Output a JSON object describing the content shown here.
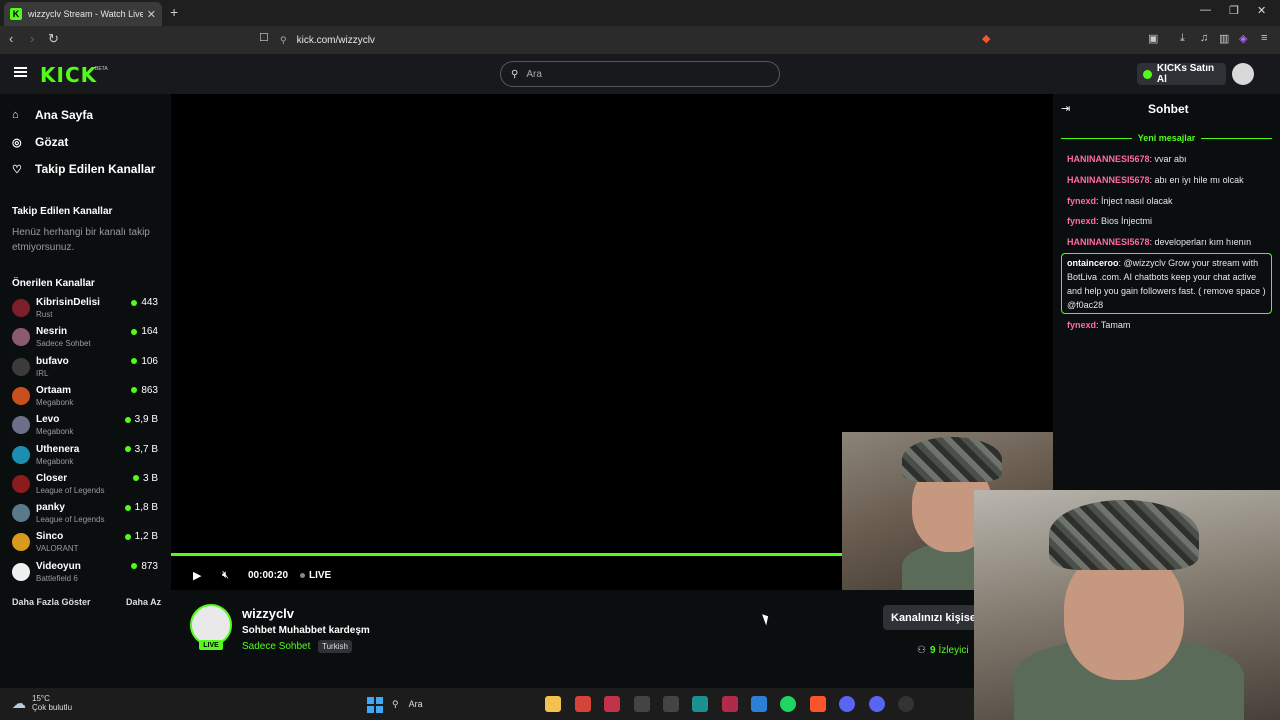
{
  "browser": {
    "tab_title": "wizzyclv Stream - Watch Live on Kick",
    "tab_favicon": "K",
    "url": "kick.com/wizzyclv"
  },
  "header": {
    "logo": "KICK",
    "logo_badge": "BETA",
    "search_placeholder": "Ara",
    "kicks_button": "KICKs Satın Al"
  },
  "sidebar": {
    "nav": [
      {
        "label": "Ana Sayfa",
        "icon": "home-icon"
      },
      {
        "label": "Gözat",
        "icon": "compass-icon"
      },
      {
        "label": "Takip Edilen Kanallar",
        "icon": "heart-icon"
      }
    ],
    "followed_heading": "Takip Edilen Kanallar",
    "followed_empty": "Henüz herhangi bir kanalı takip etmiyorsunuz.",
    "recommended_heading": "Önerilen Kanallar",
    "channels": [
      {
        "name": "KibrisinDelisi",
        "category": "Rust",
        "viewers": "443",
        "color": "#7a1f2b"
      },
      {
        "name": "Nesrin",
        "category": "Sadece Sohbet",
        "viewers": "164",
        "color": "#8b5a6e"
      },
      {
        "name": "bufavo",
        "category": "IRL",
        "viewers": "106",
        "color": "#3b3b3b"
      },
      {
        "name": "Ortaam",
        "category": "Megabonk",
        "viewers": "863",
        "color": "#c8501e"
      },
      {
        "name": "Levo",
        "category": "Megabonk",
        "viewers": "3,9 B",
        "color": "#6b6f8a"
      },
      {
        "name": "Uthenera",
        "category": "Megabonk",
        "viewers": "3,7 B",
        "color": "#1c8fb0"
      },
      {
        "name": "Closer",
        "category": "League of Legends",
        "viewers": "3 B",
        "color": "#8a1c1c"
      },
      {
        "name": "panky",
        "category": "League of Legends",
        "viewers": "1,8 B",
        "color": "#5a7a8a"
      },
      {
        "name": "Sinco",
        "category": "VALORANT",
        "viewers": "1,2 B",
        "color": "#d89a1c"
      },
      {
        "name": "Videoyun",
        "category": "Battlefield 6",
        "viewers": "873",
        "color": "#f0f0f0"
      }
    ],
    "show_more": "Daha Fazla Göster",
    "show_less": "Daha Az"
  },
  "player": {
    "time": "00:00:20",
    "live_label": "LIVE",
    "progress": 1.0
  },
  "stream_info": {
    "channel_name": "wizzyclv",
    "avatar_live": "LIVE",
    "title": "Sohbet Muhabbet kardeşm",
    "category": "Sadece Sohbet",
    "language": "Turkish",
    "customize_button": "Kanalınızı kişise",
    "viewer_count": "9",
    "viewer_label": "İzleyici"
  },
  "chat": {
    "title": "Sohbet",
    "new_messages": "Yeni mesajlar",
    "messages": [
      {
        "user": "HANINANNESI5678",
        "text": ": vvar abı",
        "color": "#ff6b9d"
      },
      {
        "user": "HANINANNESI5678",
        "text": ": abı en iyı hile mı olcak",
        "color": "#ff6b9d"
      },
      {
        "user": "fynexd",
        "text": ": İnject nasıl olacak",
        "color": "#ff6b9d"
      },
      {
        "user": "fynexd",
        "text": ": Bios İnjectmi",
        "color": "#ff6b9d"
      },
      {
        "user": "HANINANNESI5678",
        "text": ": developerları kım hıenın",
        "color": "#ff6b9d"
      },
      {
        "user": "ontainceroo",
        "text": ": @wizzyclv Grow your stream with BotLiva .com. AI chatbots keep your chat active and help you gain followers fast. ( remove space ) @f0ac28",
        "color": "#ffffff"
      },
      {
        "user": "fynexd",
        "text": ": Tamam",
        "color": "#ff6b9d"
      }
    ]
  },
  "taskbar": {
    "temperature": "15°C",
    "weather": "Çok bulutlu",
    "search": "Ara"
  },
  "colors": {
    "accent": "#53fc18",
    "background": "#0b0e0f",
    "header": "#18191c"
  }
}
